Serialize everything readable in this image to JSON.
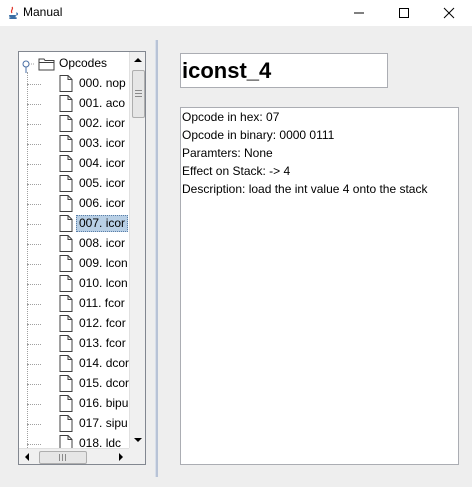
{
  "window": {
    "title": "Manual",
    "buttons": {
      "minimize": "minimize-icon",
      "maximize": "maximize-icon",
      "close": "close-icon"
    }
  },
  "tree": {
    "root_label": "Opcodes",
    "items": [
      {
        "label": "000. nop",
        "selected": false
      },
      {
        "label": "001. aco",
        "selected": false
      },
      {
        "label": "002. icor",
        "selected": false
      },
      {
        "label": "003. icor",
        "selected": false
      },
      {
        "label": "004. icor",
        "selected": false
      },
      {
        "label": "005. icor",
        "selected": false
      },
      {
        "label": "006. icor",
        "selected": false
      },
      {
        "label": "007. icor",
        "selected": true
      },
      {
        "label": "008. icor",
        "selected": false
      },
      {
        "label": "009. lcon",
        "selected": false
      },
      {
        "label": "010. lcon",
        "selected": false
      },
      {
        "label": "011. fcor",
        "selected": false
      },
      {
        "label": "012. fcor",
        "selected": false
      },
      {
        "label": "013. fcor",
        "selected": false
      },
      {
        "label": "014. dcor",
        "selected": false
      },
      {
        "label": "015. dcor",
        "selected": false
      },
      {
        "label": "016. bipu",
        "selected": false
      },
      {
        "label": "017. sipu",
        "selected": false
      },
      {
        "label": "018. ldc",
        "selected": false
      }
    ]
  },
  "detail": {
    "heading": "iconst_4",
    "lines": [
      "Opcode in hex: 07",
      "Opcode in binary: 0000 0111",
      "Paramters: None",
      "Effect on Stack: -> 4",
      "Description: load the int value 4 onto the stack"
    ]
  },
  "colors": {
    "selection": "#b8cfe5",
    "panel_border": "#828790",
    "background": "#eeeeee"
  }
}
